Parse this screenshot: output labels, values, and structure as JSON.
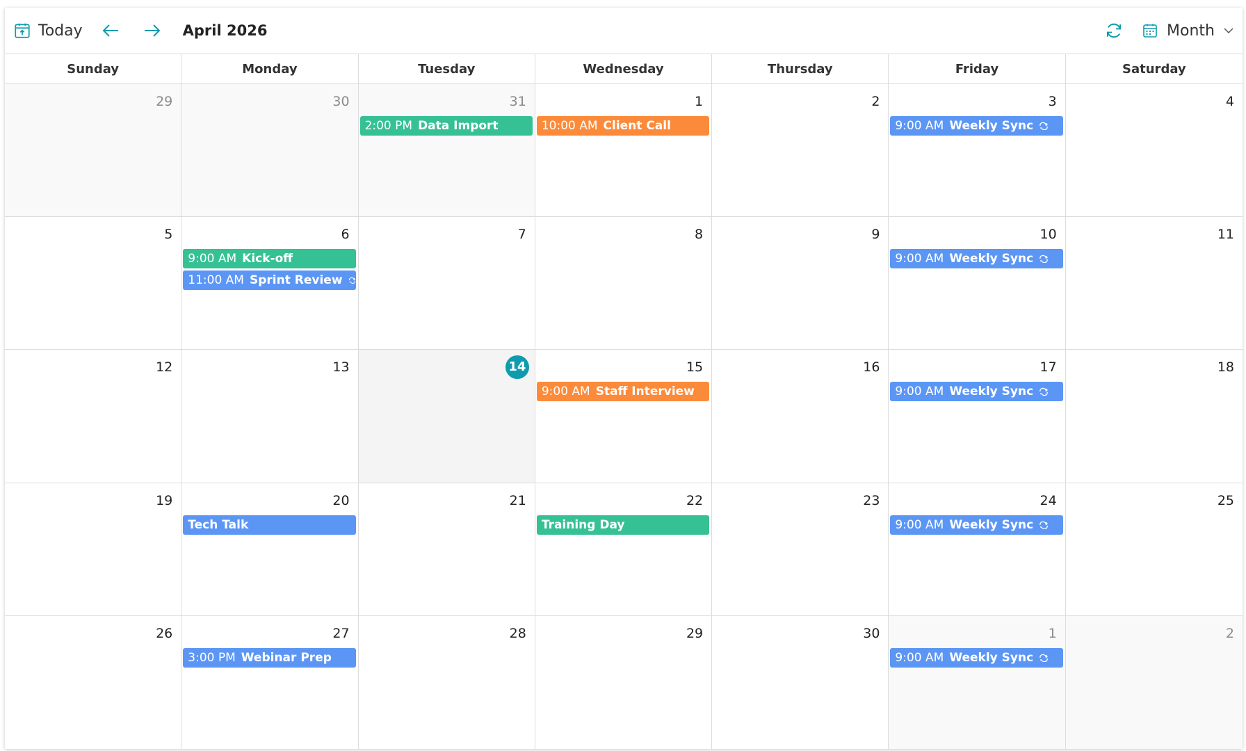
{
  "toolbar": {
    "today_label": "Today",
    "date_range": "April 2026",
    "view_label": "Month",
    "accent": "#0e9bad"
  },
  "weekdays": [
    "Sunday",
    "Monday",
    "Tuesday",
    "Wednesday",
    "Thursday",
    "Friday",
    "Saturday"
  ],
  "colors": {
    "green": "#35c194",
    "orange": "#fb8b3b",
    "blue": "#5c96f5",
    "today_badge": "#0e9bad"
  },
  "weeks": [
    [
      {
        "day": "29",
        "other": true,
        "events": []
      },
      {
        "day": "30",
        "other": true,
        "events": []
      },
      {
        "day": "31",
        "other": true,
        "events": [
          {
            "time": "2:00 PM",
            "title": "Data Import",
            "color": "green",
            "recurring": false
          }
        ]
      },
      {
        "day": "1",
        "events": [
          {
            "time": "10:00 AM",
            "title": "Client Call",
            "color": "orange",
            "recurring": false
          }
        ]
      },
      {
        "day": "2",
        "events": []
      },
      {
        "day": "3",
        "events": [
          {
            "time": "9:00 AM",
            "title": "Weekly Sync",
            "color": "blue",
            "recurring": true
          }
        ]
      },
      {
        "day": "4",
        "events": []
      }
    ],
    [
      {
        "day": "5",
        "events": []
      },
      {
        "day": "6",
        "events": [
          {
            "time": "9:00 AM",
            "title": "Kick-off",
            "color": "green",
            "recurring": false
          },
          {
            "time": "11:00 AM",
            "title": "Sprint Review",
            "color": "blue",
            "recurring": true
          }
        ]
      },
      {
        "day": "7",
        "events": []
      },
      {
        "day": "8",
        "events": []
      },
      {
        "day": "9",
        "events": []
      },
      {
        "day": "10",
        "events": [
          {
            "time": "9:00 AM",
            "title": "Weekly Sync",
            "color": "blue",
            "recurring": true
          }
        ]
      },
      {
        "day": "11",
        "events": []
      }
    ],
    [
      {
        "day": "12",
        "events": []
      },
      {
        "day": "13",
        "events": []
      },
      {
        "day": "14",
        "today": true,
        "events": []
      },
      {
        "day": "15",
        "events": [
          {
            "time": "9:00 AM",
            "title": "Staff Interview",
            "color": "orange",
            "recurring": false
          }
        ]
      },
      {
        "day": "16",
        "events": []
      },
      {
        "day": "17",
        "events": [
          {
            "time": "9:00 AM",
            "title": "Weekly Sync",
            "color": "blue",
            "recurring": true
          }
        ]
      },
      {
        "day": "18",
        "events": []
      }
    ],
    [
      {
        "day": "19",
        "events": []
      },
      {
        "day": "20",
        "events": [
          {
            "time": "",
            "title": "Tech Talk",
            "color": "blue",
            "recurring": false
          }
        ]
      },
      {
        "day": "21",
        "events": []
      },
      {
        "day": "22",
        "events": [
          {
            "time": "",
            "title": "Training Day",
            "color": "green",
            "recurring": false
          }
        ]
      },
      {
        "day": "23",
        "events": []
      },
      {
        "day": "24",
        "events": [
          {
            "time": "9:00 AM",
            "title": "Weekly Sync",
            "color": "blue",
            "recurring": true
          }
        ]
      },
      {
        "day": "25",
        "events": []
      }
    ],
    [
      {
        "day": "26",
        "events": []
      },
      {
        "day": "27",
        "events": [
          {
            "time": "3:00 PM",
            "title": "Webinar Prep",
            "color": "blue",
            "recurring": false
          }
        ]
      },
      {
        "day": "28",
        "events": []
      },
      {
        "day": "29",
        "events": []
      },
      {
        "day": "30",
        "events": []
      },
      {
        "day": "1",
        "other": true,
        "events": [
          {
            "time": "9:00 AM",
            "title": "Weekly Sync",
            "color": "blue",
            "recurring": true
          }
        ]
      },
      {
        "day": "2",
        "other": true,
        "events": []
      }
    ]
  ]
}
